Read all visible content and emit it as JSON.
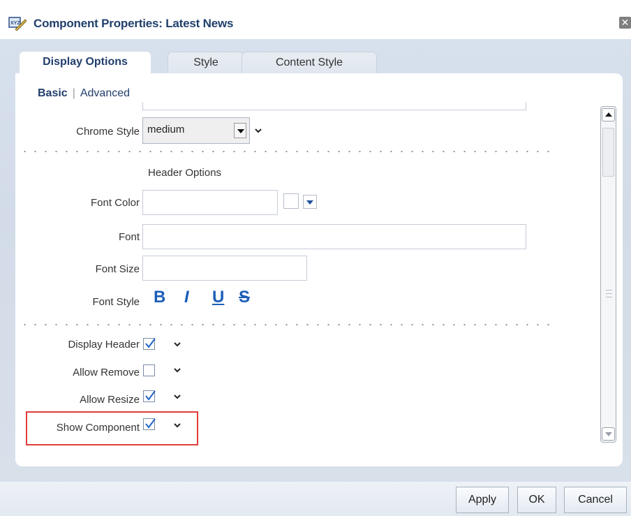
{
  "dialog": {
    "title": "Component Properties: Latest News",
    "title_icon": "xyz-icon",
    "close_icon": "close-icon"
  },
  "tabs": [
    {
      "label": "Display Options",
      "active": true
    },
    {
      "label": "Style",
      "active": false
    },
    {
      "label": "Content Style",
      "active": false
    }
  ],
  "subtabs": {
    "basic": "Basic",
    "advanced": "Advanced"
  },
  "chrome_style": {
    "label": "Chrome Style",
    "value": "medium"
  },
  "header_options": {
    "heading": "Header Options",
    "font_color_label": "Font Color",
    "font_color_value": "",
    "font_label": "Font",
    "font_value": "",
    "font_size_label": "Font Size",
    "font_size_value": "",
    "font_style_label": "Font Style",
    "font_style_buttons": [
      "B",
      "I",
      "U",
      "S"
    ]
  },
  "options": [
    {
      "label": "Display Header",
      "checked": true
    },
    {
      "label": "Allow Remove",
      "checked": false
    },
    {
      "label": "Allow Resize",
      "checked": true
    },
    {
      "label": "Show Component",
      "checked": true
    }
  ],
  "footer": {
    "apply": "Apply",
    "ok": "OK",
    "cancel": "Cancel"
  },
  "colors": {
    "accent": "#213f6c",
    "highlight_box": "#e23b3b",
    "style_buttons": "#1c5eb8",
    "checkmark": "#1f64c4"
  }
}
